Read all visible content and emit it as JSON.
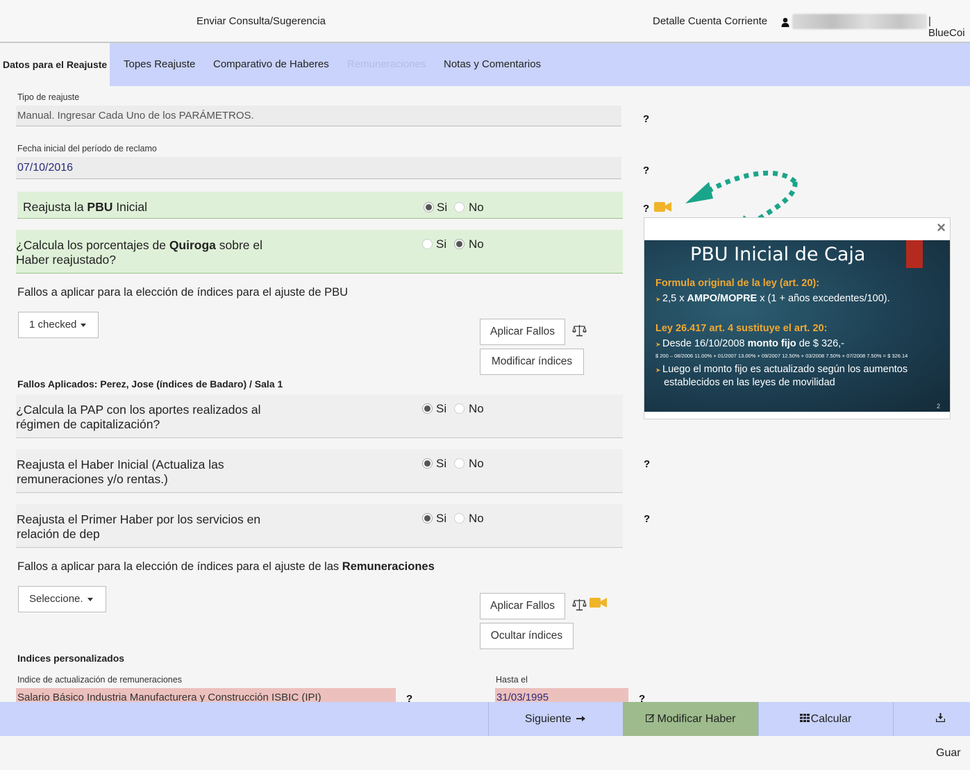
{
  "header": {
    "send_query": "Enviar Consulta/Sugerencia",
    "account_detail": "Detalle Cuenta Corriente",
    "brand_suffix": "| BlueCoi"
  },
  "tabs": [
    {
      "label": "Datos para el Reajuste"
    },
    {
      "label": "Topes Reajuste"
    },
    {
      "label": "Comparativo de Haberes"
    },
    {
      "label": "Remuneraciones"
    },
    {
      "label": "Notas y Comentarios"
    }
  ],
  "form": {
    "tipo_label": "Tipo de reajuste",
    "tipo_value": "Manual. Ingresar Cada Uno de los PARÁMETROS.",
    "fecha_label": "Fecha inicial del período de reclamo",
    "fecha_value": "07/10/2016",
    "help": "?",
    "yes": "Si",
    "no": "No",
    "q1_pre": "Reajusta la ",
    "q1_bold": "PBU",
    "q1_post": " Inicial",
    "q2_pre": "¿Calcula los porcentajes de ",
    "q2_bold": "Quiroga",
    "q2_post": " sobre el",
    "q2_line2": "Haber reajustado?",
    "fallos_pbu_label": "Fallos a aplicar para la elección de índices para el ajuste de PBU",
    "fallos_pbu_dropdown": "1 checked",
    "aplicar_fallos": "Aplicar Fallos",
    "modificar_indices": "Modificar índices",
    "fallos_aplicados": "Fallos Aplicados: Perez, Jose (índices de Badaro)  /  Sala 1",
    "q3_line1": "¿Calcula la PAP con los aportes realizados al",
    "q3_line2": "régimen de capitalización?",
    "q4_line1": "Reajusta el Haber Inicial (Actualiza las",
    "q4_line2": "remuneraciones y/o rentas.)",
    "q5_line1": "Reajusta el Primer Haber por los servicios en",
    "q5_line2": "relación de dep",
    "fallos_rem_label_pre": "Fallos a aplicar para la elección de índices para el ajuste de las ",
    "fallos_rem_label_bold": "Remuneraciones",
    "fallos_rem_dropdown": "Seleccione.",
    "ocultar_indices": "Ocultar índices",
    "indices_personalizados": "Indices personalizados",
    "indice_label": "Indice de actualización de remuneraciones",
    "indice_value": "Salario Básico Industria Manufacturera y Construcción ISBIC (IPI)",
    "hasta_label": "Hasta el",
    "hasta_value": "31/03/1995"
  },
  "answers": {
    "q1": "si",
    "q2": "no",
    "q3": "si",
    "q4": "si",
    "q5": "si"
  },
  "popup": {
    "close": "×",
    "slide_title": "PBU Inicial de Caja",
    "h1": "Formula original de la ley (art. 20):",
    "b1_pre": "2,5 x ",
    "b1_bold": "AMPO/MOPRE",
    "b1_post": " x (1 + años excedentes/100).",
    "h2": "Ley 26.417 art. 4 sustituye el art. 20:",
    "b2_pre": "Desde 16/10/2008 ",
    "b2_bold": "monto fijo",
    "b2_post": " de $ 326,-",
    "tiny": "$ 200 – 08/2006 11.00% + 01/2007 13.00% + 09/2007 12.50% + 03/2008 7.50% + 07/2008 7.50% = $ 326.14",
    "b3_line1": "Luego el monto fijo es actualizado según los aumentos",
    "b3_line2": "establecidos en las leyes de movilidad",
    "page_no": "2"
  },
  "icons": {
    "user": "user-icon",
    "video": "video-camera-icon",
    "scale": "balance-scale-icon",
    "arrow": "arrow-right-icon",
    "edit": "edit-icon",
    "grid": "grid-icon",
    "download": "download-icon"
  },
  "colors": {
    "tab_bar": "#c9d3fb",
    "green_row": "#dff0d8",
    "green_button": "#9dbb8c",
    "annotation_arrow": "#1aa58a",
    "video_icon": "#f0b429",
    "pink_field": "#ecc0bd"
  },
  "bottom": {
    "siguiente": "Siguiente",
    "modificar_haber": "Modificar Haber",
    "calcular": "Calcular",
    "guardar": "Guar"
  }
}
